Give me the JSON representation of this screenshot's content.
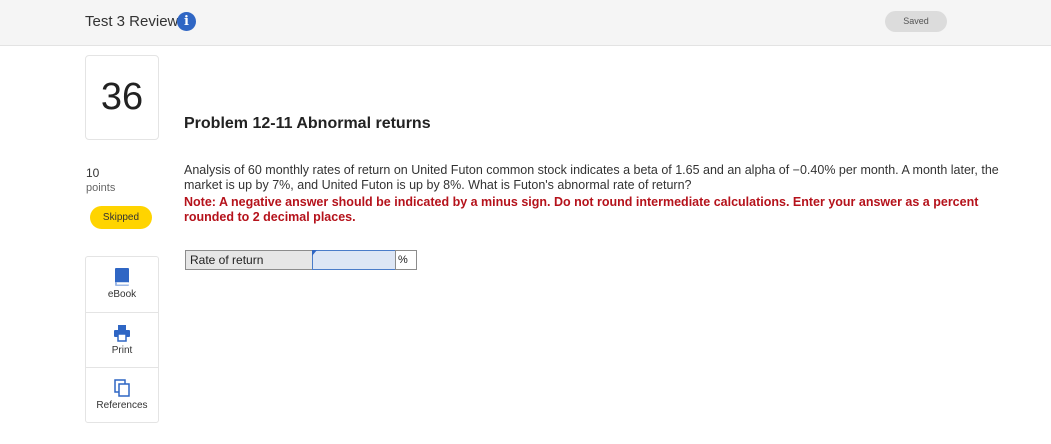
{
  "header": {
    "title": "Test 3 Review",
    "info_icon": "info-icon",
    "status_pill": "Saved"
  },
  "question": {
    "number": "36",
    "points_value": "10",
    "points_label": "points",
    "status": "Skipped",
    "status_color": "#ffd400"
  },
  "tools": [
    {
      "label": "eBook",
      "icon": "book-icon"
    },
    {
      "label": "Print",
      "icon": "printer-icon"
    },
    {
      "label": "References",
      "icon": "copy-icon"
    }
  ],
  "problem": {
    "title": "Problem 12-11 Abnormal returns",
    "body": "Analysis of 60 monthly rates of return on United Futon common stock indicates a beta of 1.65 and an alpha of −0.40% per month. A month later, the market is up by 7%, and United Futon is up by 8%. What is Futon's abnormal rate of return?",
    "note": "Note: A negative answer should be indicated by a minus sign. Do not round intermediate calculations. Enter your answer as a percent rounded to 2 decimal places.",
    "note_color": "#b5121b"
  },
  "answer": {
    "label": "Rate of return",
    "value": "",
    "unit": "%"
  }
}
